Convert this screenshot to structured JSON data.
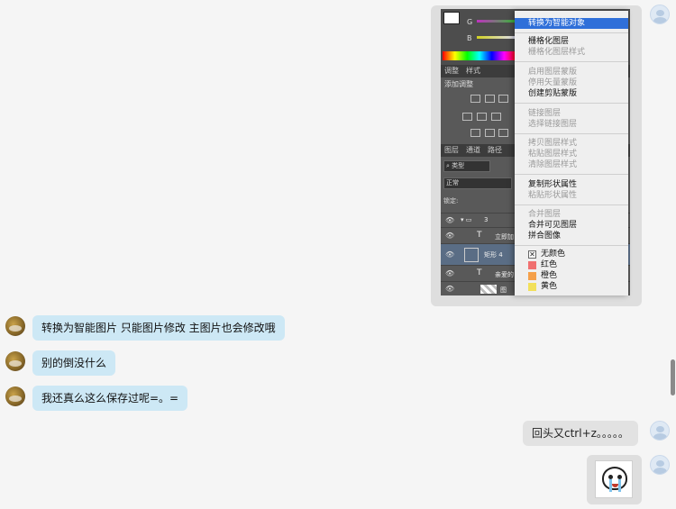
{
  "ps_screenshot": {
    "channels": {
      "g_label": "G",
      "b_label": "B"
    },
    "panel_tabs": {
      "adjust": "调整",
      "styles": "样式"
    },
    "adjust_title": "添加调整",
    "layer_tabs": {
      "layers": "图层",
      "channels": "通道",
      "paths": "路径"
    },
    "search_label": "类型",
    "blend_mode": "正常",
    "lock_label": "锁定:",
    "layers": [
      {
        "name": "3",
        "kind": "group"
      },
      {
        "name": "立即加",
        "kind": "text"
      },
      {
        "name": "矩形 4",
        "kind": "shape"
      },
      {
        "name": "亲爱的",
        "kind": "text"
      },
      {
        "name": "图",
        "kind": "image"
      }
    ],
    "context_menu": {
      "items": [
        {
          "label": "转换为智能对象",
          "state": "highlighted"
        },
        {
          "label": "栅格化图层",
          "state": "enabled"
        },
        {
          "label": "栅格化图层样式",
          "state": "disabled"
        },
        {
          "label": "启用图层蒙版",
          "state": "disabled"
        },
        {
          "label": "停用矢量蒙版",
          "state": "disabled"
        },
        {
          "label": "创建剪贴蒙版",
          "state": "enabled"
        },
        {
          "label": "链接图层",
          "state": "disabled"
        },
        {
          "label": "选择链接图层",
          "state": "disabled"
        },
        {
          "label": "拷贝图层样式",
          "state": "disabled"
        },
        {
          "label": "粘贴图层样式",
          "state": "disabled"
        },
        {
          "label": "清除图层样式",
          "state": "disabled"
        },
        {
          "label": "复制形状属性",
          "state": "enabled"
        },
        {
          "label": "粘贴形状属性",
          "state": "disabled"
        },
        {
          "label": "合并图层",
          "state": "disabled"
        },
        {
          "label": "合并可见图层",
          "state": "enabled"
        },
        {
          "label": "拼合图像",
          "state": "enabled"
        }
      ],
      "colors": [
        {
          "label": "无颜色",
          "swatch": "#ffffff"
        },
        {
          "label": "红色",
          "swatch": "#f07070"
        },
        {
          "label": "橙色",
          "swatch": "#f5a04a"
        },
        {
          "label": "黄色",
          "swatch": "#f2e05a"
        }
      ]
    }
  },
  "messages": {
    "m1": "转换为智能图片 只能图片修改 主图片也会修改哦",
    "m2": "别的倒没什么",
    "m3": "我还真么这么保存过呢=。=",
    "m4": "回头又ctrl+z。。。。。"
  },
  "colors": {
    "incoming_bubble": "#cde8f5",
    "outgoing_bubble": "#e2e2e2",
    "menu_highlight": "#2f6fd9"
  }
}
